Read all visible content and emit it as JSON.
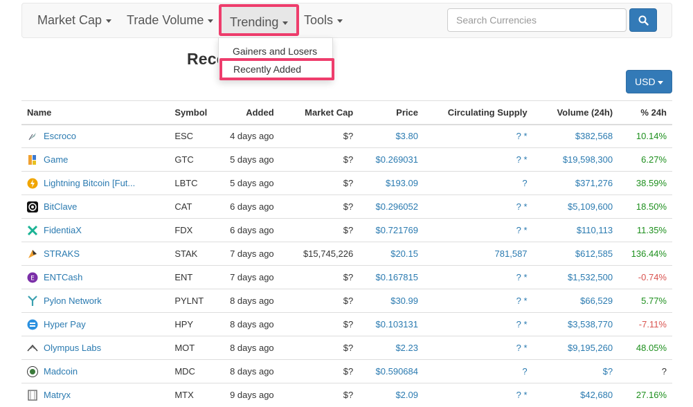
{
  "nav": {
    "market_cap": "Market Cap",
    "trade_volume": "Trade Volume",
    "trending": "Trending",
    "tools": "Tools",
    "search_placeholder": "Search Currencies"
  },
  "dropdown": {
    "gainers_losers": "Gainers and Losers",
    "recently_added": "Recently Added"
  },
  "page_title": "Recently Added",
  "currency_button": "USD",
  "table": {
    "headers": {
      "name": "Name",
      "symbol": "Symbol",
      "added": "Added",
      "market_cap": "Market Cap",
      "price": "Price",
      "supply": "Circulating Supply",
      "volume": "Volume (24h)",
      "change": "% 24h"
    },
    "rows": [
      {
        "icon": "escroco-icon",
        "name": "Escroco",
        "symbol": "ESC",
        "added": "4 days ago",
        "market_cap": "$?",
        "price": "$3.80",
        "supply": "? *",
        "volume": "$382,568",
        "change": "10.14%",
        "dir": "pos"
      },
      {
        "icon": "game-icon",
        "name": "Game",
        "symbol": "GTC",
        "added": "5 days ago",
        "market_cap": "$?",
        "price": "$0.269031",
        "supply": "? *",
        "volume": "$19,598,300",
        "change": "6.27%",
        "dir": "pos"
      },
      {
        "icon": "lightning-bitcoin-icon",
        "name": "Lightning Bitcoin [Fut...",
        "symbol": "LBTC",
        "added": "5 days ago",
        "market_cap": "$?",
        "price": "$193.09",
        "supply": "?",
        "volume": "$371,276",
        "change": "38.59%",
        "dir": "pos"
      },
      {
        "icon": "bitclave-icon",
        "name": "BitClave",
        "symbol": "CAT",
        "added": "6 days ago",
        "market_cap": "$?",
        "price": "$0.296052",
        "supply": "? *",
        "volume": "$5,109,600",
        "change": "18.50%",
        "dir": "pos"
      },
      {
        "icon": "fidentiax-icon",
        "name": "FidentiaX",
        "symbol": "FDX",
        "added": "6 days ago",
        "market_cap": "$?",
        "price": "$0.721769",
        "supply": "? *",
        "volume": "$110,113",
        "change": "11.35%",
        "dir": "pos"
      },
      {
        "icon": "straks-icon",
        "name": "STRAKS",
        "symbol": "STAK",
        "added": "7 days ago",
        "market_cap": "$15,745,226",
        "price": "$20.15",
        "supply": "781,587",
        "volume": "$612,585",
        "change": "136.44%",
        "dir": "pos"
      },
      {
        "icon": "entcash-icon",
        "name": "ENTCash",
        "symbol": "ENT",
        "added": "7 days ago",
        "market_cap": "$?",
        "price": "$0.167815",
        "supply": "? *",
        "volume": "$1,532,500",
        "change": "-0.74%",
        "dir": "neg"
      },
      {
        "icon": "pylon-network-icon",
        "name": "Pylon Network",
        "symbol": "PYLNT",
        "added": "8 days ago",
        "market_cap": "$?",
        "price": "$30.99",
        "supply": "? *",
        "volume": "$66,529",
        "change": "5.77%",
        "dir": "pos"
      },
      {
        "icon": "hyper-pay-icon",
        "name": "Hyper Pay",
        "symbol": "HPY",
        "added": "8 days ago",
        "market_cap": "$?",
        "price": "$0.103131",
        "supply": "? *",
        "volume": "$3,538,770",
        "change": "-7.11%",
        "dir": "neg"
      },
      {
        "icon": "olympus-labs-icon",
        "name": "Olympus Labs",
        "symbol": "MOT",
        "added": "8 days ago",
        "market_cap": "$?",
        "price": "$2.23",
        "supply": "? *",
        "volume": "$9,195,260",
        "change": "48.05%",
        "dir": "pos"
      },
      {
        "icon": "madcoin-icon",
        "name": "Madcoin",
        "symbol": "MDC",
        "added": "8 days ago",
        "market_cap": "$?",
        "price": "$0.590684",
        "supply": "?",
        "volume": "$?",
        "change": "?",
        "dir": "none"
      },
      {
        "icon": "matryx-icon",
        "name": "Matryx",
        "symbol": "MTX",
        "added": "9 days ago",
        "market_cap": "$?",
        "price": "$2.09",
        "supply": "? *",
        "volume": "$42,680",
        "change": "27.16%",
        "dir": "pos"
      }
    ]
  }
}
